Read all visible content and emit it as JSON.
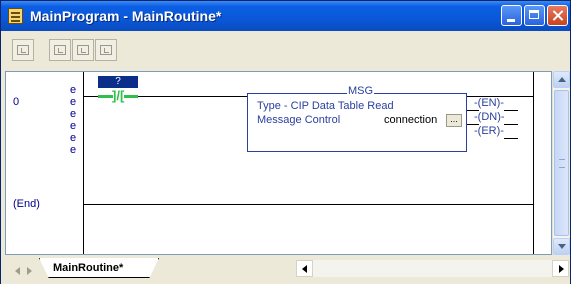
{
  "window": {
    "title": "MainProgram - MainRoutine*",
    "icon": "ladder-routine-icon"
  },
  "toolbar": {
    "buttons": [
      "verify-routine-icon",
      "rung-edit-icon",
      "rung-accept-icon",
      "rung-cancel-icon"
    ]
  },
  "ladder": {
    "rung_number": "0",
    "end_label": "(End)",
    "edit_markers": [
      "e",
      "e",
      "e",
      "e",
      "e",
      "e"
    ],
    "contact": {
      "tag": "?",
      "symbol": "]/["
    },
    "msg": {
      "title": "MSG",
      "type_line": "Type - CIP Data Table Read",
      "control_label": "Message Control",
      "control_value": "connection",
      "browse_label": "...",
      "outputs": [
        "EN",
        "DN",
        "ER"
      ]
    }
  },
  "tabs": {
    "active": "MainRoutine*"
  },
  "colors": {
    "title_bar": "#0a58d8",
    "contact_energized": "#2ec04a",
    "instruction_text": "#2a3f9e",
    "tag_highlight": "#0a2e8a"
  }
}
